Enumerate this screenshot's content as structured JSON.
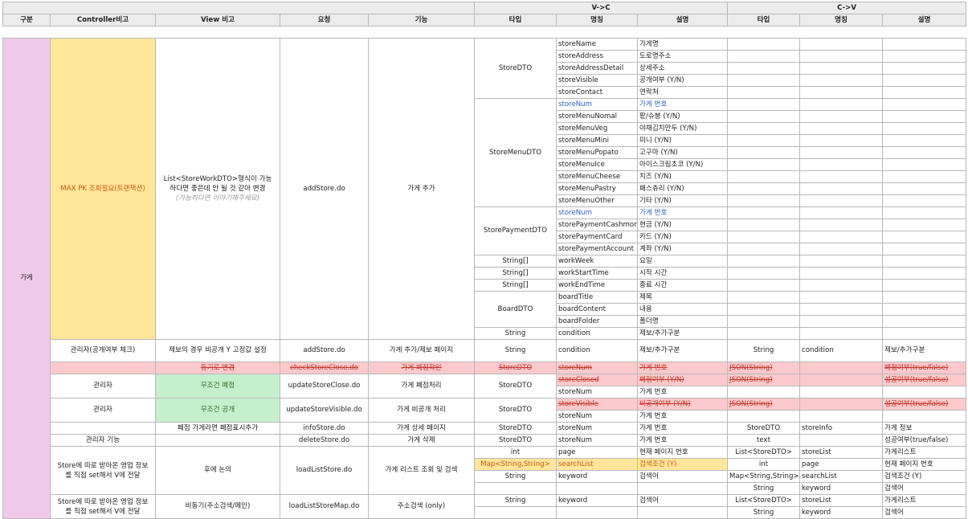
{
  "header": {
    "group_vc": "V->C",
    "group_cv": "C->V",
    "col_category": "구분",
    "col_controller": "Controller비고",
    "col_view": "View 비고",
    "col_request": "요청",
    "col_function": "기능",
    "col_type": "타입",
    "col_name": "명칭",
    "col_desc": "설명",
    "col_type2": "타입",
    "col_name2": "명칭",
    "col_desc2": "설명"
  },
  "category": "가게",
  "addStore": {
    "controller": "MAX PK 조회필요(트랜잭션)",
    "view_line1": "List<StoreWorkDTO>형식이 가능",
    "view_line2": "하다면 좋은데 안 될 것 같아 변경",
    "view_line3": "(가능하다면 이야기해주세요)",
    "request": "addStore.do",
    "function": "가게 추가",
    "groups": [
      {
        "type": "StoreDTO",
        "fields": [
          {
            "name": "storeName",
            "desc": "가게명"
          },
          {
            "name": "storeAddress",
            "desc": "도로명주소"
          },
          {
            "name": "storeAddressDetail",
            "desc": "상세주소"
          },
          {
            "name": "storeVisible",
            "desc": "공개여부 (Y/N)"
          },
          {
            "name": "storeContact",
            "desc": "연락처"
          }
        ]
      },
      {
        "type": "StoreMenuDTO",
        "fields": [
          {
            "name": "storeNum",
            "desc": "가게 번호"
          },
          {
            "name": "storeMenuNomal",
            "desc": "팥/슈붕 (Y/N)"
          },
          {
            "name": "storeMenuVeg",
            "desc": "야채김치만두 (Y/N)"
          },
          {
            "name": "storeMenuMini",
            "desc": "미니 (Y/N)"
          },
          {
            "name": "storeMenuPopato",
            "desc": "고구마 (Y/N)"
          },
          {
            "name": "storeMenuIce",
            "desc": "아이스크림초코 (Y/N)"
          },
          {
            "name": "storeMenuCheese",
            "desc": "치즈 (Y/N)"
          },
          {
            "name": "storeMenuPastry",
            "desc": "패스츄리 (Y/N)"
          },
          {
            "name": "storeMenuOther",
            "desc": "기타 (Y/N)"
          }
        ]
      },
      {
        "type": "StorePaymentDTO",
        "fields": [
          {
            "name": "storeNum",
            "desc": "가게 번호"
          },
          {
            "name": "storePaymentCashmoney",
            "desc": "현금 (Y/N)"
          },
          {
            "name": "storePaymentCard",
            "desc": "카드 (Y/N)"
          },
          {
            "name": "storePaymentAccount",
            "desc": "계좌 (Y/N)"
          }
        ]
      },
      {
        "type": "String[]",
        "fields": [
          {
            "name": "workWeek",
            "desc": "요일"
          }
        ]
      },
      {
        "type": "String[]",
        "fields": [
          {
            "name": "workStartTime",
            "desc": "시작 시간"
          }
        ]
      },
      {
        "type": "String[]",
        "fields": [
          {
            "name": "workEndTime",
            "desc": "종료 시간"
          }
        ]
      },
      {
        "type": "BoardDTO",
        "fields": [
          {
            "name": "boardTitle",
            "desc": "제목"
          },
          {
            "name": "boardContent",
            "desc": "내용"
          },
          {
            "name": "boardFolder",
            "desc": "폴더명"
          }
        ]
      },
      {
        "type": "String",
        "fields": [
          {
            "name": "condition",
            "desc": "제보/추가구분"
          }
        ]
      }
    ]
  },
  "rows": {
    "r1": {
      "controller": "관리자(공개여부 체크)",
      "view": "제보의 경우 비공개 Y 고정값 설정",
      "request": "addStore.do",
      "function": "가게 추가/제보 페이지",
      "type": "String",
      "name": "condition",
      "desc": "제보/추가구분",
      "type2": "String",
      "name2": "condition",
      "desc2": "제보/추가구분"
    },
    "r2": {
      "view": "동기로 변경",
      "request": "checkStoreClose.do",
      "function": "가게 폐점확인",
      "type": "StoreDTO",
      "name": "storeNum",
      "desc": "가게 번호",
      "type2": "JSON(String)",
      "desc2": "폐점여부(true/false)"
    },
    "r3": {
      "controller": "관리자",
      "view": "무조건 폐점",
      "request": "updateStoreClose.do",
      "function": "가게 폐점처리",
      "type": "StoreDTO",
      "name_a": "storeClosed",
      "desc_a": "폐점여부 (Y/N)",
      "name_b": "storeNum",
      "desc_b": "가게 번호",
      "type2": "JSON(String)",
      "desc2": "성공여부(true/false)"
    },
    "r4": {
      "controller": "관리자",
      "view": "무조건 공개",
      "request": "updateStoreVisible.do",
      "function": "가게 비공개 처리",
      "type": "StoreDTO",
      "name_a": "storeVisible",
      "desc_a": "비공개여부 (Y/N)",
      "name_b": "storeNum",
      "desc_b": "가게 번호",
      "type2": "JSON(String)",
      "desc2": "성공여부(true/false)"
    },
    "r5": {
      "view": "폐점 가게라면 폐점표시추가",
      "request": "infoStore.do",
      "function": "가게 상세 페이지",
      "type": "StoreDTO",
      "name": "storeNum",
      "desc": "가게 번호",
      "type2": "StoreDTO",
      "name2": "storeInfo",
      "desc2": "가게 정보"
    },
    "r6": {
      "controller": "관리자 기능",
      "request": "deleteStore.do",
      "function": "가게 삭제",
      "type": "StoreDTO",
      "name": "storeNum",
      "desc": "가게 번호",
      "type2": "text",
      "desc2": "성공여부(true/false)"
    },
    "r7": {
      "controller_line1": "Store에 따로 받아온 영업 정보",
      "controller_line2": "를 직접 set해서 V에 전달",
      "view": "후에 논의",
      "request": "loadListStore.do",
      "function": "가게 리스트 조회 및 검색",
      "lines": [
        {
          "type": "int",
          "name": "page",
          "desc": "현재 페이지 번호",
          "type2": "List<StoreDTO>",
          "name2": "storeList",
          "desc2": "가게리스트"
        },
        {
          "type": "Map<String,String>",
          "name": "searchList",
          "desc": "검색조건 (Y)",
          "type2": "int",
          "name2": "page",
          "desc2": "현재 페이지 번호"
        },
        {
          "type": "String",
          "name": "keyword",
          "desc": "검색어",
          "type2": "Map<String,String>",
          "name2": "searchList",
          "desc2": "검색조건 (Y)"
        },
        {
          "type": "",
          "name": "",
          "desc": "",
          "type2": "String",
          "name2": "keyword",
          "desc2": "검색어"
        }
      ]
    },
    "r8": {
      "controller_line1": "Store에 따로 받아온 영업 정보",
      "controller_line2": "를 직접 set해서 V에 전달",
      "view": "비동기(주소검색/메인)",
      "request": "loadListStoreMap.do",
      "function": "주소검색 (only)",
      "lines": [
        {
          "type": "String",
          "name": "keyword",
          "desc": "검색어",
          "type2": "List<StoreDTO>",
          "name2": "storeList",
          "desc2": "가게리스트"
        },
        {
          "type": "",
          "name": "",
          "desc": "",
          "type2": "String",
          "name2": "keyword",
          "desc2": "검색어"
        }
      ]
    }
  }
}
